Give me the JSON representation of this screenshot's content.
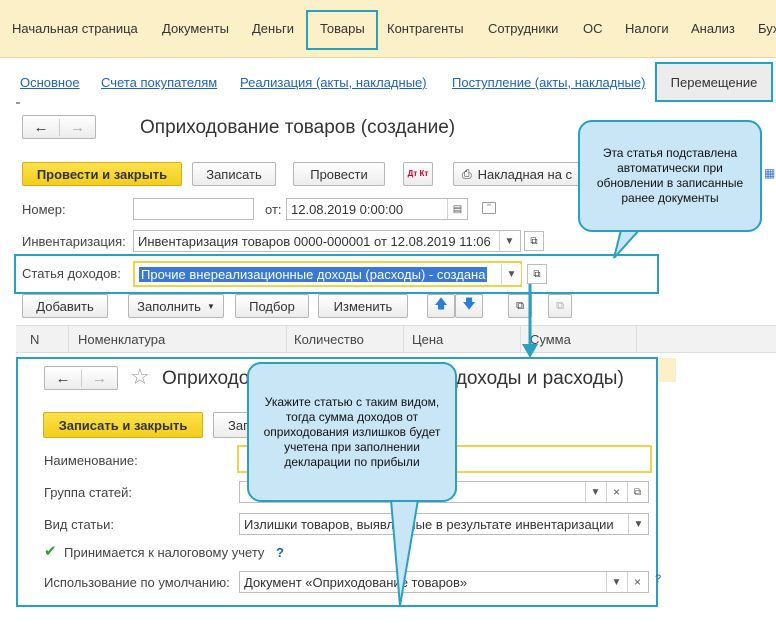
{
  "topnav": {
    "items": [
      "Начальная страница",
      "Документы",
      "Деньги",
      "Товары",
      "Контрагенты",
      "Сотрудники",
      "ОС",
      "Налоги",
      "Анализ",
      "Бух"
    ]
  },
  "subnav": {
    "links": [
      "Основное",
      "Счета покупателям",
      "Реализация (акты, накладные)",
      "Поступление (акты, накладные)"
    ],
    "active_tab": "Перемещение"
  },
  "document": {
    "title": "Оприходование товаров (создание)",
    "buttons": {
      "post_and_close": "Провести и закрыть",
      "save": "Записать",
      "post": "Провести",
      "dt_kt": "Дт Кт",
      "print_invoice": "Накладная на с"
    },
    "number_label": "Номер:",
    "number_value": "",
    "from_label": "от:",
    "date_value": "12.08.2019  0:00:00",
    "inventory_label": "Инвентаризация:",
    "inventory_value": "Инвентаризация товаров 0000-000001 от 12.08.2019 11:06",
    "income_item_label": "Статья доходов:",
    "income_item_value": "Прочие внереализационные доходы (расходы) - создана",
    "table_buttons": {
      "add": "Добавить",
      "fill": "Заполнить",
      "select": "Подбор",
      "change": "Изменить"
    },
    "table_columns": [
      "N",
      "Номенклатура",
      "Количество",
      "Цена",
      "Сумма"
    ]
  },
  "subform": {
    "title_left": "Оприходов",
    "title_right": "е доходы и расходы)",
    "buttons": {
      "save_and_close": "Записать и закрыть",
      "save_partial": "Запи"
    },
    "name_label": "Наименование:",
    "name_value": "",
    "group_label": "Группа статей:",
    "group_value": "",
    "kind_label": "Вид статьи:",
    "kind_value": "Излишки товаров, выявленные в результате инвентаризации",
    "tax_checkbox_label": "Принимается к налоговому учету",
    "tax_checked": true,
    "help_mark": "?",
    "default_use_label": "Использование по умолчанию:",
    "default_use_value": "Документ «Оприходование товаров»"
  },
  "callouts": {
    "top": "Эта статья подставлена автоматически при обновлении в записанные ранее документы",
    "middle": "Укажите статью с таким видом, тогда сумма доходов от оприходования излишков будет учетена при заполнении декларации по прибыли"
  },
  "colors": {
    "accent_frame": "#2aa0c0",
    "topbar_bg": "#fbf0c7",
    "primary_button": "#f3cd1a",
    "link": "#1d63b7",
    "selection": "#3a78d6"
  }
}
